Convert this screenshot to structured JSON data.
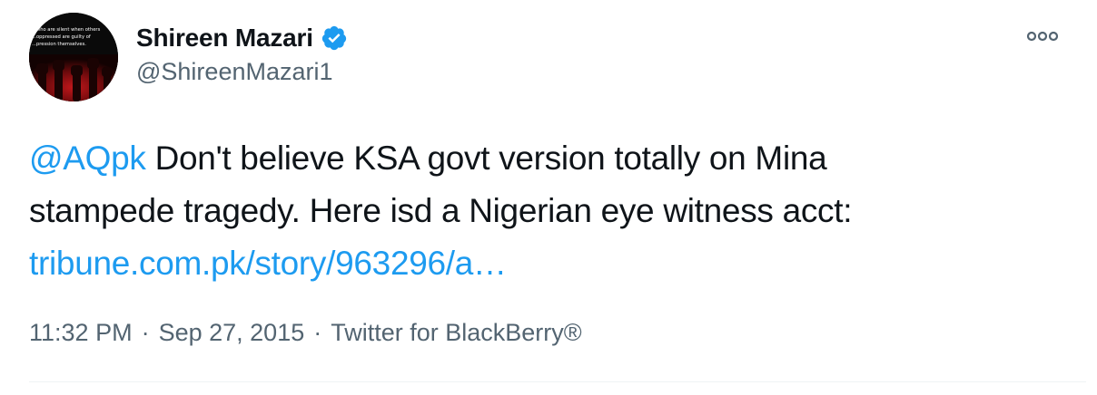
{
  "author": {
    "display_name": "Shireen Mazari",
    "handle": "@ShireenMazari1",
    "verified_icon": "verified-badge-icon",
    "avatar_text": [
      "...who are silent when others",
      "...oppressed are guilty of",
      "...pression themselves."
    ]
  },
  "menu": {
    "icon": "more-options-icon"
  },
  "tweet": {
    "mention": "@AQpk",
    "text_line1": " Don't believe KSA govt version totally on Mina",
    "text_line2": "stampede tragedy. Here isd a Nigerian eye witness acct:",
    "link": "tribune.com.pk/story/963296/a…"
  },
  "meta": {
    "time": "11:32 PM",
    "separator": "·",
    "date": "Sep 27, 2015",
    "source": "Twitter for BlackBerry®"
  },
  "colors": {
    "link": "#1d9bf0",
    "secondary_text": "#536471",
    "primary_text": "#0f1419",
    "divider": "#eff3f4"
  }
}
